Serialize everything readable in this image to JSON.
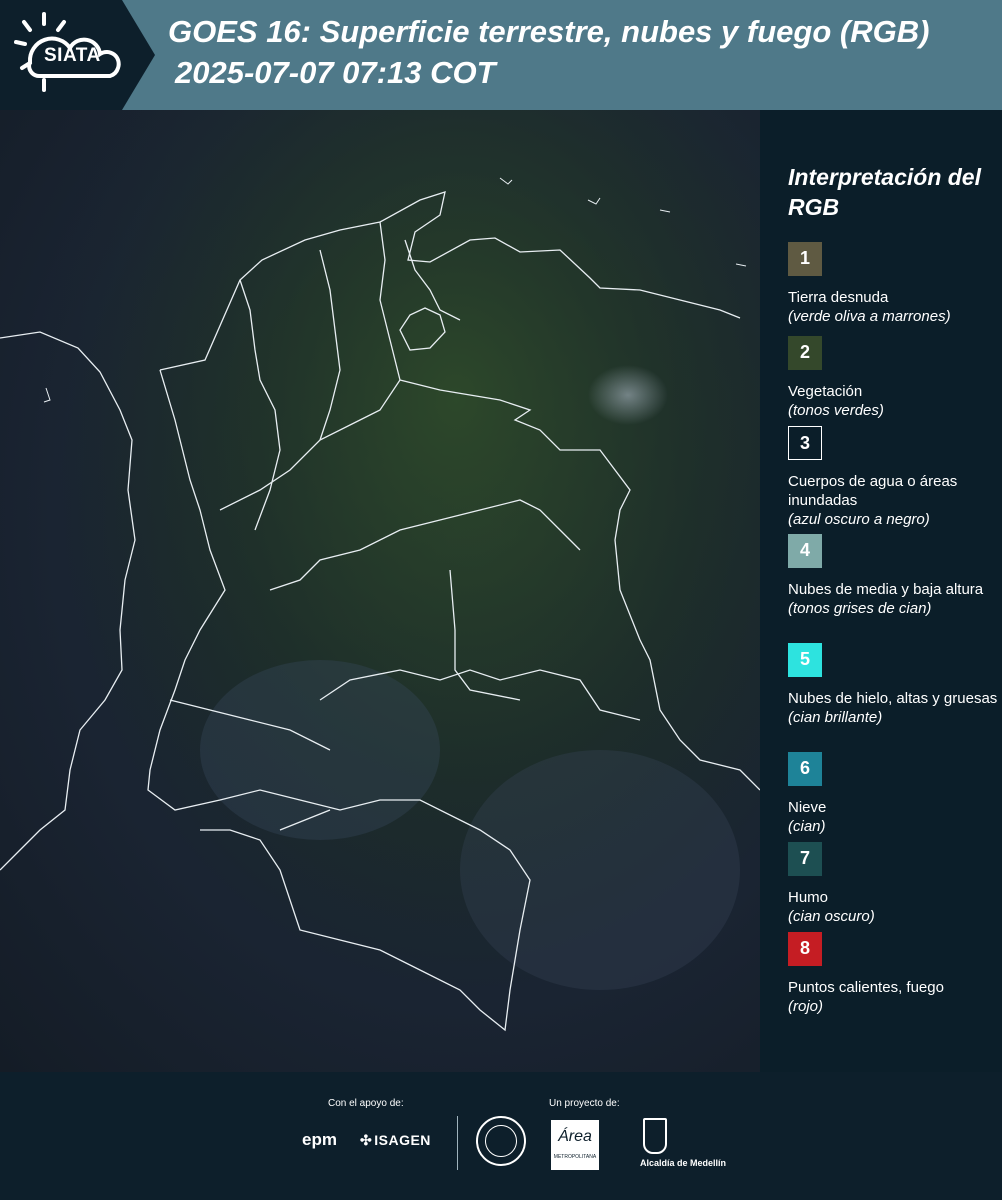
{
  "header": {
    "logo_text": "SIATA",
    "title_line_1": "GOES 16: Superficie terrestre, nubes y fuego (RGB)",
    "title_line_2": "2025-07-07 07:13 COT"
  },
  "map": {
    "layer_type": "satellite RGB",
    "background_color": "#1a2432",
    "border_color": "#e8eef2"
  },
  "legend": {
    "title": "Interpretación del RGB",
    "items": [
      {
        "number": "1",
        "label": "Tierra desnuda",
        "note": "(verde oliva a marrones)",
        "color": "#5f5a42"
      },
      {
        "number": "2",
        "label": "Vegetación",
        "note": "(tonos verdes)",
        "color": "#34482b"
      },
      {
        "number": "3",
        "label": "Cuerpos de agua o áreas inundadas",
        "note": "(azul oscuro a negro)",
        "color": "#0b1e29"
      },
      {
        "number": "4",
        "label": "Nubes de media y baja altura",
        "note": "(tonos grises de cian)",
        "color": "#7faaa8"
      },
      {
        "number": "5",
        "label": "Nubes de hielo, altas y gruesas",
        "note": "(cian brillante)",
        "color": "#2de3df"
      },
      {
        "number": "6",
        "label": "Nieve",
        "note": "(cian)",
        "color": "#1e8398"
      },
      {
        "number": "7",
        "label": "Humo",
        "note": "(cian oscuro)",
        "color": "#1d4f52"
      },
      {
        "number": "8",
        "label": "Puntos calientes, fuego",
        "note": "(rojo)",
        "color": "#c51d23"
      }
    ]
  },
  "footer": {
    "support_label": "Con el apoyo de:",
    "project_label": "Un proyecto de:",
    "epm_logo": "epm",
    "isagen_logo": "ISAGEN",
    "area_logo": "Área",
    "area_logo_sub": "METROPOLITANA",
    "medellin_label": "Alcaldía de Medellín"
  }
}
